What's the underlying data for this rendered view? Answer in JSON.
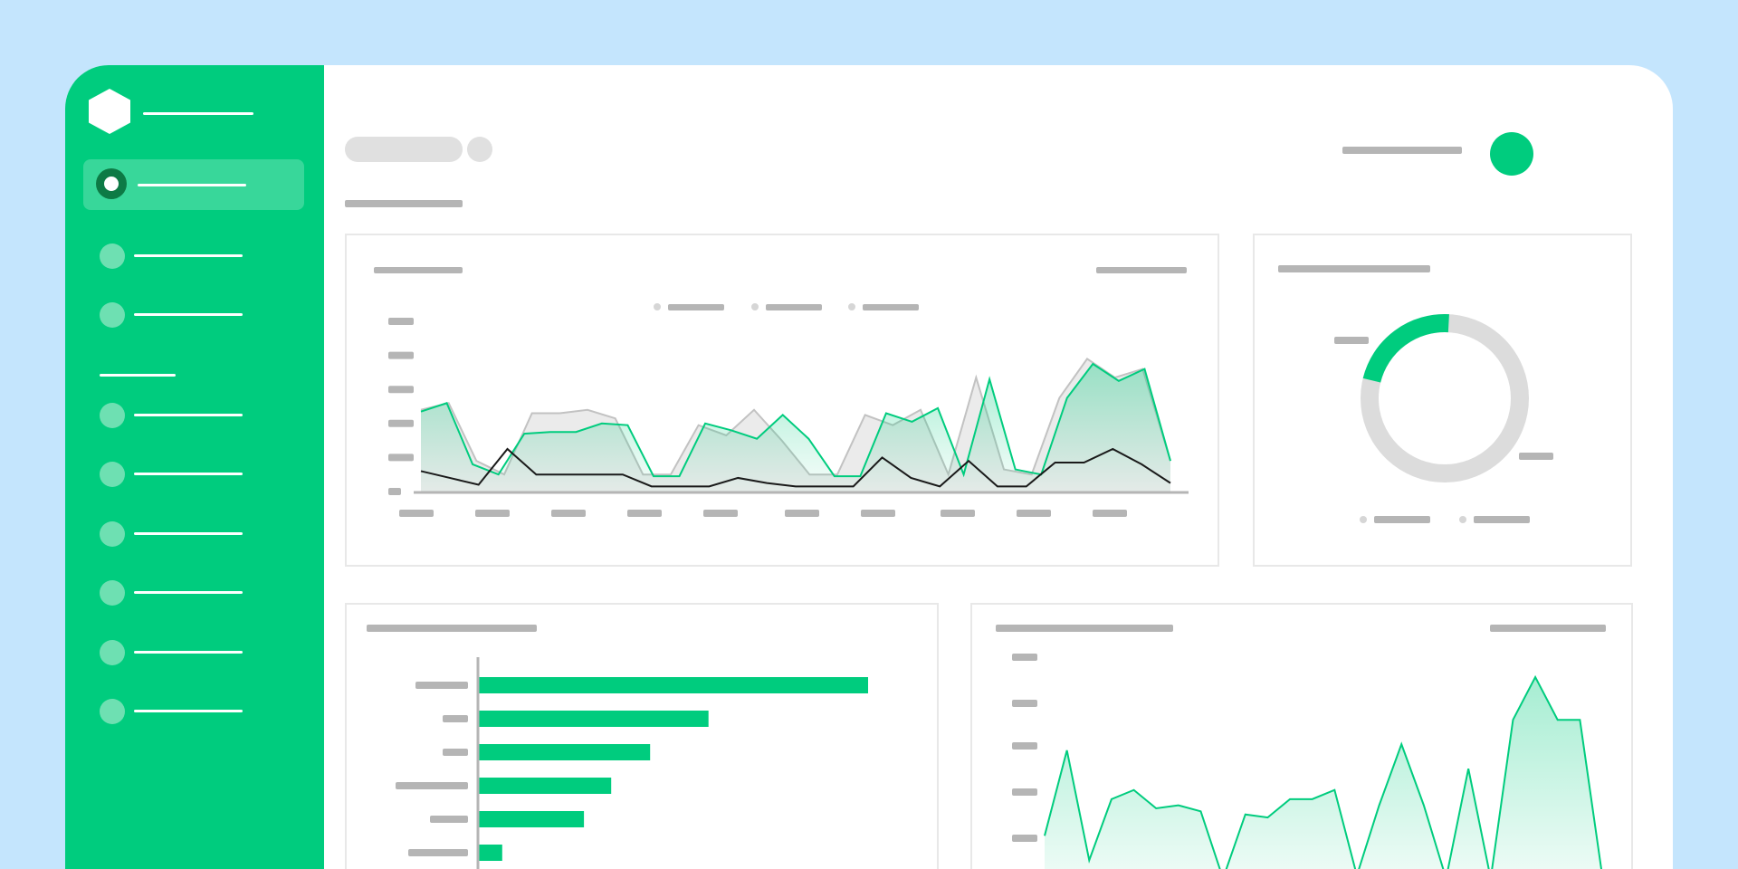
{
  "theme": {
    "background": "#c4e5fd",
    "sidebar": "#00cc7e",
    "accent": "#00cc7e",
    "accent_light": "#6ee0b2",
    "placeholder_grey": "#b5b5b5"
  },
  "sidebar": {
    "logo_icon": "hexagon-logo-icon",
    "items": [
      {
        "icon": "radio-selected-icon",
        "active": true
      },
      {
        "icon": "circle-icon"
      },
      {
        "icon": "circle-icon"
      },
      {
        "icon": "circle-icon"
      },
      {
        "icon": "circle-icon"
      },
      {
        "icon": "circle-icon"
      },
      {
        "icon": "circle-icon"
      },
      {
        "icon": "circle-icon"
      },
      {
        "icon": "circle-icon"
      }
    ]
  },
  "header": {
    "avatar_icon": "avatar-icon"
  },
  "trend_chart": {
    "series": [
      {
        "values": [
          48,
          52,
          18,
          10,
          46,
          46,
          48,
          43,
          10,
          10,
          39,
          33,
          48,
          30,
          10,
          10,
          45,
          39,
          48,
          10,
          67,
          13,
          10,
          55,
          78,
          67,
          72,
          18
        ],
        "color": "#d4d4d4"
      },
      {
        "values": [
          47,
          52,
          16,
          10,
          34,
          35,
          35,
          40,
          39,
          9,
          9,
          40,
          36,
          31,
          45,
          31,
          9,
          9,
          46,
          41,
          49,
          10,
          66,
          13,
          10,
          55,
          75,
          65,
          72,
          18
        ],
        "color": "#00cc7e"
      },
      {
        "values": [
          12,
          8,
          4,
          25,
          10,
          10,
          10,
          10,
          3,
          3,
          3,
          8,
          5,
          3,
          3,
          3,
          20,
          8,
          3,
          18,
          3,
          3,
          17,
          17,
          25,
          16,
          5
        ],
        "color": "#1a1a1a"
      }
    ]
  },
  "donut": {
    "values": [
      22,
      78
    ],
    "colors": [
      "#00cc7e",
      "#dcdcdc"
    ]
  },
  "bar_chart": {
    "values": [
      100,
      59,
      44,
      34,
      27,
      6
    ],
    "color": "#00cc7e"
  },
  "area_chart": {
    "values": [
      18,
      46,
      10,
      30,
      33,
      27,
      28,
      26,
      4,
      25,
      24,
      30,
      30,
      33,
      5,
      28,
      48,
      28,
      4,
      40,
      4,
      56,
      70,
      56,
      56,
      5
    ],
    "color": "#00cc7e"
  }
}
